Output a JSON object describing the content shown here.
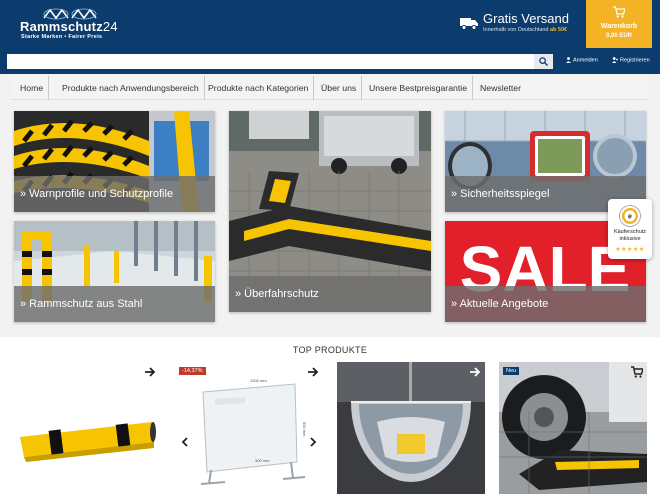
{
  "header": {
    "logo_name": "Rammschutz",
    "logo_num": "24",
    "logo_tagline": "Starke Marken • Fairer Preis",
    "shipping_title": "Gratis Versand",
    "shipping_sub": "Innerhalb von Deutschland",
    "shipping_threshold": "ab 50€",
    "cart_label": "Warenkorb",
    "cart_sum": "0,00 EUR",
    "login_label": "Anmelden",
    "register_label": "Registrieren"
  },
  "search": {
    "value": "",
    "placeholder": ""
  },
  "nav": {
    "items": [
      {
        "label": "Home"
      },
      {
        "label": "Produkte nach Anwendungsbereich"
      },
      {
        "label": "Produkte nach Kategorien"
      },
      {
        "label": "Über uns"
      },
      {
        "label": "Unsere Bestpreisgarantie"
      },
      {
        "label": "Newsletter"
      }
    ]
  },
  "tiles": [
    {
      "label": "» Warnprofile und Schutzprofile"
    },
    {
      "label": "» Überfahrschutz"
    },
    {
      "label": "» Sicherheitsspiegel"
    },
    {
      "label": "» Rammschutz aus Stahl"
    },
    {
      "label": "» Aktuelle Angebote"
    }
  ],
  "sale_text": "SALE",
  "trust_badge": {
    "line1": "Käuferschutz",
    "line2": "inklusive",
    "stars": "★★★★★"
  },
  "top_products": {
    "title": "TOP PRODUKTE",
    "items": [
      {
        "badge": ""
      },
      {
        "badge": "-14,37%",
        "dim_top": "1000 mm",
        "dim_side": "800 mm",
        "dim_bottom": "300 mm"
      },
      {
        "badge": ""
      },
      {
        "badge": "Neu"
      }
    ]
  },
  "colors": {
    "navy": "#0c3c6e",
    "accent": "#f4b225",
    "sale_red": "#e2202a",
    "discount_red": "#c0392b"
  }
}
